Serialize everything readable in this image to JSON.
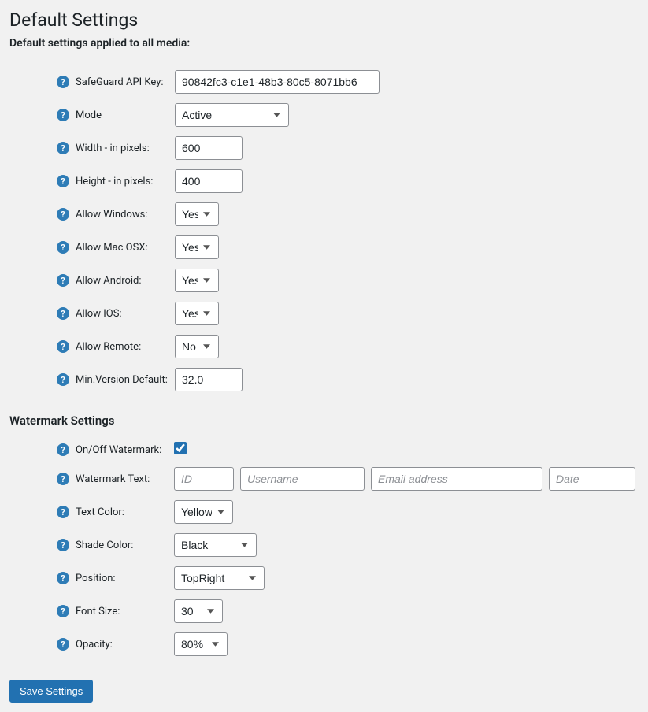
{
  "headings": {
    "default_settings": "Default Settings",
    "description": "Default settings applied to all media:",
    "watermark_settings": "Watermark Settings"
  },
  "defaults": {
    "api_key_label": "SafeGuard API Key:",
    "api_key_value": "90842fc3-c1e1-48b3-80c5-8071bb6",
    "mode_label": "Mode",
    "mode_value": "Active",
    "width_label": "Width - in pixels:",
    "width_value": "600",
    "height_label": "Height - in pixels:",
    "height_value": "400",
    "allow_windows_label": "Allow Windows:",
    "allow_windows_value": "Yes",
    "allow_mac_label": "Allow Mac OSX:",
    "allow_mac_value": "Yes",
    "allow_android_label": "Allow Android:",
    "allow_android_value": "Yes",
    "allow_ios_label": "Allow IOS:",
    "allow_ios_value": "Yes",
    "allow_remote_label": "Allow Remote:",
    "allow_remote_value": "No",
    "min_version_label": "Min.Version Default:",
    "min_version_value": "32.0"
  },
  "watermark": {
    "onoff_label": "On/Off Watermark:",
    "onoff_checked": true,
    "text_label": "Watermark Text:",
    "placeholder_id": "ID",
    "placeholder_username": "Username",
    "placeholder_email": "Email address",
    "placeholder_date": "Date",
    "text_color_label": "Text Color:",
    "text_color_value": "Yellow",
    "shade_color_label": "Shade Color:",
    "shade_color_value": "Black",
    "position_label": "Position:",
    "position_value": "TopRight",
    "font_size_label": "Font Size:",
    "font_size_value": "30",
    "opacity_label": "Opacity:",
    "opacity_value": "80%"
  },
  "button": {
    "save_label": "Save Settings"
  }
}
